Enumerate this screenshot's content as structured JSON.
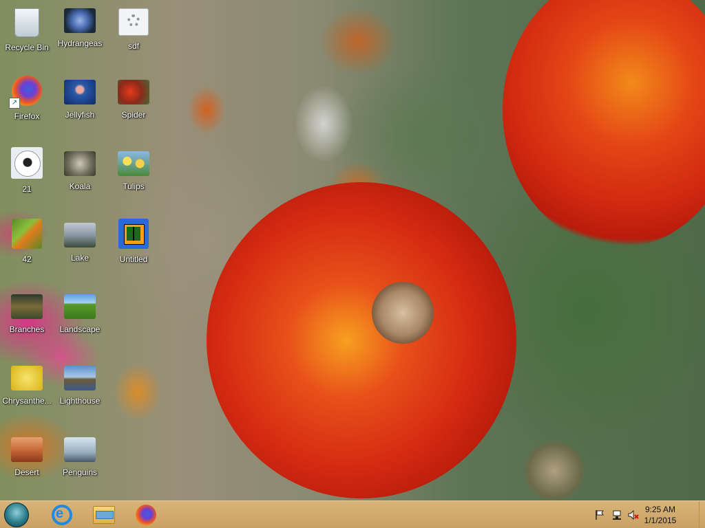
{
  "desktop": {
    "icons": [
      {
        "id": "recycle-bin",
        "label": "Recycle Bin",
        "icon": "recycle-bin-icon"
      },
      {
        "id": "hydrangeas",
        "label": "Hydrangeas",
        "icon": "image-file-icon"
      },
      {
        "id": "sdf",
        "label": "sdf",
        "icon": "settings-file-icon"
      },
      {
        "id": "firefox",
        "label": "Firefox",
        "icon": "firefox-icon"
      },
      {
        "id": "jellyfish",
        "label": "Jellyfish",
        "icon": "image-file-icon"
      },
      {
        "id": "spider",
        "label": "Spider",
        "icon": "image-file-icon"
      },
      {
        "id": "21",
        "label": "21",
        "icon": "soccer-ball-icon"
      },
      {
        "id": "koala",
        "label": "Koala",
        "icon": "image-file-icon"
      },
      {
        "id": "tulips",
        "label": "Tulips",
        "icon": "image-file-icon"
      },
      {
        "id": "42",
        "label": "42",
        "icon": "image-file-icon"
      },
      {
        "id": "lake",
        "label": "Lake",
        "icon": "image-file-icon"
      },
      {
        "id": "untitled",
        "label": "Untitled",
        "icon": "app-icon"
      },
      {
        "id": "branches",
        "label": "Branches",
        "icon": "image-file-icon"
      },
      {
        "id": "landscape",
        "label": "Landscape",
        "icon": "image-file-icon"
      },
      {
        "id": "chrysanthemum",
        "label": "Chrysanthe...",
        "icon": "image-file-icon"
      },
      {
        "id": "lighthouse",
        "label": "Lighthouse",
        "icon": "image-file-icon"
      },
      {
        "id": "desert",
        "label": "Desert",
        "icon": "image-file-icon"
      },
      {
        "id": "penguins",
        "label": "Penguins",
        "icon": "image-file-icon"
      }
    ]
  },
  "taskbar": {
    "start": {
      "icon": "start-orb-icon"
    },
    "pinned": [
      {
        "id": "ie",
        "icon": "internet-explorer-icon"
      },
      {
        "id": "explorer",
        "icon": "file-explorer-icon"
      },
      {
        "id": "firefox",
        "icon": "firefox-icon"
      }
    ],
    "tray": {
      "time": "9:25 AM",
      "date": "1/1/2015",
      "icons": [
        "action-center-flag-icon",
        "network-icon",
        "volume-muted-icon"
      ]
    }
  },
  "colors": {
    "taskbar": "#cfa86d",
    "label_text": "#ffffff"
  }
}
